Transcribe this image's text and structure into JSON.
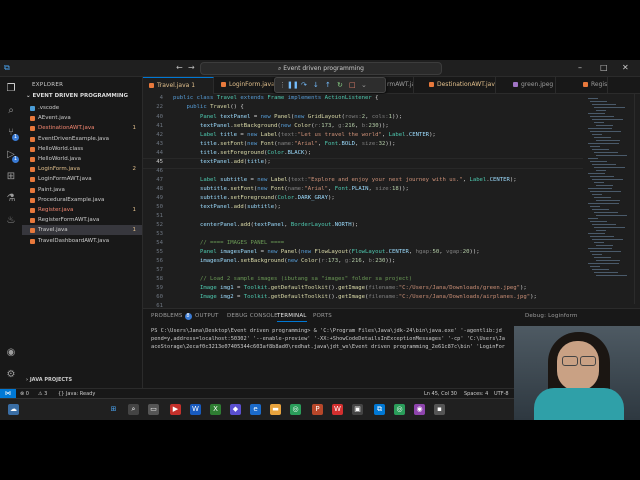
{
  "titlebar": {
    "search_text": "Event driven programming",
    "back": "←",
    "forward": "→"
  },
  "activity_badges": {
    "scm": "1",
    "run": "1"
  },
  "sidebar": {
    "header": "EXPLORER",
    "section": "EVENT DRIVEN PROGRAMMING",
    "bottom_section": "JAVA PROJECTS",
    "files": [
      {
        "name": ".vscode",
        "count": "",
        "state": "folder"
      },
      {
        "name": "AEvent.java",
        "count": "",
        "state": "normal"
      },
      {
        "name": "DestinationAWT.java",
        "count": "1",
        "state": "err"
      },
      {
        "name": "EventDrivenExample.java",
        "count": "",
        "state": "normal"
      },
      {
        "name": "HelloWorld.class",
        "count": "",
        "state": "normal"
      },
      {
        "name": "HelloWorld.java",
        "count": "",
        "state": "normal"
      },
      {
        "name": "LoginForm.java",
        "count": "2",
        "state": "mod"
      },
      {
        "name": "LoginFormAWT.java",
        "count": "",
        "state": "normal"
      },
      {
        "name": "Paint.java",
        "count": "",
        "state": "normal"
      },
      {
        "name": "ProceduralExample.java",
        "count": "",
        "state": "normal"
      },
      {
        "name": "Register.java",
        "count": "1",
        "state": "err"
      },
      {
        "name": "RegisterFormAWT.java",
        "count": "",
        "state": "normal"
      },
      {
        "name": "Travel.java",
        "count": "1",
        "state": "sel"
      },
      {
        "name": "TravelDashboardAWT.java",
        "count": "",
        "state": "normal"
      }
    ]
  },
  "tabs": [
    {
      "label": "Travel.java 1",
      "state": "active"
    },
    {
      "label": "LoginForm.java 2",
      "state": "modified"
    },
    {
      "label": "rmAWT.java",
      "state": "normal"
    },
    {
      "label": "DestinationAWT.java 1",
      "state": "modified"
    },
    {
      "label": "green.jpeg",
      "state": "normal"
    },
    {
      "label": "Regis",
      "state": "normal"
    }
  ],
  "breadcrumb_lines": [
    {
      "num": "4",
      "html": "<span class='k'>public class</span> <span class='c'>Travel</span> <span class='k'>extends</span> <span class='c'>Frame</span> <span class='k'>implements</span> <span class='c'>ActionListener</span> {"
    },
    {
      "num": "22",
      "html": "    <span class='k'>public</span> <span class='f'>Travel</span>() {"
    }
  ],
  "code_lines": [
    {
      "num": "40",
      "html": "        <span class='c'>Panel</span> <span class='v'>textPanel</span> = <span class='k'>new</span> <span class='f'>Panel</span>(<span class='k'>new</span> <span class='f'>GridLayout</span>(<span class='h'>rows:</span><span class='n'>2</span>, <span class='h'>cols:</span><span class='n'>1</span>));"
    },
    {
      "num": "41",
      "html": "        <span class='v'>textPanel</span>.<span class='f'>setBackground</span>(<span class='k'>new</span> <span class='f'>Color</span>(<span class='h'>r:</span><span class='n'>173</span>, <span class='h'>g:</span><span class='n'>216</span>, <span class='h'>b:</span><span class='n'>230</span>));"
    },
    {
      "num": "42",
      "html": "        <span class='c'>Label</span> <span class='v'>title</span> = <span class='k'>new</span> <span class='f'>Label</span>(<span class='h'>text:</span><span class='s'>\"Let us travel the world\"</span>, <span class='c'>Label</span>.<span class='v'>CENTER</span>);"
    },
    {
      "num": "43",
      "html": "        <span class='v'>title</span>.<span class='f'>setFont</span>(<span class='k'>new</span> <span class='f'>Font</span>(<span class='h'>name:</span><span class='s'>\"Arial\"</span>, <span class='c'>Font</span>.<span class='v'>BOLD</span>, <span class='h'>size:</span><span class='n'>32</span>));"
    },
    {
      "num": "44",
      "html": "        <span class='v'>title</span>.<span class='f'>setForeground</span>(<span class='c'>Color</span>.<span class='v'>BLACK</span>);"
    },
    {
      "num": "45",
      "html": "        <span class='v'>textPanel</span>.<span class='f'>add</span>(<span class='v'>title</span>);",
      "current": true
    },
    {
      "num": "46",
      "html": ""
    },
    {
      "num": "47",
      "html": "        <span class='c'>Label</span> <span class='v'>subtitle</span> = <span class='k'>new</span> <span class='f'>Label</span>(<span class='h'>text:</span><span class='s'>\"Explore and enjoy your next journey with us.\"</span>, <span class='c'>Label</span>.<span class='v'>CENTER</span>);"
    },
    {
      "num": "48",
      "html": "        <span class='v'>subtitle</span>.<span class='f'>setFont</span>(<span class='k'>new</span> <span class='f'>Font</span>(<span class='h'>name:</span><span class='s'>\"Arial\"</span>, <span class='c'>Font</span>.<span class='v'>PLAIN</span>, <span class='h'>size:</span><span class='n'>18</span>));"
    },
    {
      "num": "49",
      "html": "        <span class='v'>subtitle</span>.<span class='f'>setForeground</span>(<span class='c'>Color</span>.<span class='v'>DARK_GRAY</span>);"
    },
    {
      "num": "50",
      "html": "        <span class='v'>textPanel</span>.<span class='f'>add</span>(<span class='v'>subtitle</span>);"
    },
    {
      "num": "51",
      "html": ""
    },
    {
      "num": "52",
      "html": "        <span class='v'>centerPanel</span>.<span class='f'>add</span>(<span class='v'>textPanel</span>, <span class='c'>BorderLayout</span>.<span class='v'>NORTH</span>);"
    },
    {
      "num": "53",
      "html": ""
    },
    {
      "num": "54",
      "html": "        <span class='cm'>// ==== IMAGES PANEL ====</span>"
    },
    {
      "num": "55",
      "html": "        <span class='c'>Panel</span> <span class='v'>imagesPanel</span> = <span class='k'>new</span> <span class='f'>Panel</span>(<span class='k'>new</span> <span class='f'>FlowLayout</span>(<span class='c'>FlowLayout</span>.<span class='v'>CENTER</span>, <span class='h'>hgap:</span><span class='n'>50</span>, <span class='h'>vgap:</span><span class='n'>20</span>));"
    },
    {
      "num": "56",
      "html": "        <span class='v'>imagesPanel</span>.<span class='f'>setBackground</span>(<span class='k'>new</span> <span class='f'>Color</span>(<span class='h'>r:</span><span class='n'>173</span>, <span class='h'>g:</span><span class='n'>216</span>, <span class='h'>b:</span><span class='n'>230</span>));"
    },
    {
      "num": "57",
      "html": ""
    },
    {
      "num": "58",
      "html": "        <span class='cm'>// Load 2 sample images (ibutang sa \"images\" folder sa project)</span>"
    },
    {
      "num": "59",
      "html": "        <span class='c'>Image</span> <span class='v'>img1</span> = <span class='c'>Toolkit</span>.<span class='f'>getDefaultToolkit</span>().<span class='f'>getImage</span>(<span class='h'>filename:</span><span class='s'>\"C:/Users/Jana/Downloads/green.jpeg\"</span>);"
    },
    {
      "num": "60",
      "html": "        <span class='c'>Image</span> <span class='v'>img2</span> = <span class='c'>Toolkit</span>.<span class='f'>getDefaultToolkit</span>().<span class='f'>getImage</span>(<span class='h'>filename:</span><span class='s'>\"C:/Users/Jana/Downloads/airplanes.jpg\"</span>);"
    },
    {
      "num": "61",
      "html": ""
    }
  ],
  "panel": {
    "tabs": [
      "PROBLEMS",
      "OUTPUT",
      "DEBUG CONSOLE",
      "TERMINAL",
      "PORTS"
    ],
    "problems_count": "8",
    "active_tab": "TERMINAL",
    "debug_label": "Debug: Loginform",
    "terminal_lines": [
      "PS C:\\Users\\Jana\\Desktop\\Event driven programming> & 'C:\\Program Files\\Java\\jdk-24\\bin\\java.exe' '-agentlib:jd",
      "pend=y,address=localhost:50302' '--enable-preview' '-XX:+ShowCodeDetailsInExceptionMessages' '-cp' 'C:\\Users\\Ja",
      "aceStorage\\2ecaf0c3213e07405344c603af8b8ad0\\redhat.java\\jdt_ws\\Event driven programming_2e61c87c\\bin' 'LoginFor"
    ]
  },
  "statusbar": {
    "errors": "⊗ 0",
    "warnings": "⚠ 3",
    "java": "{} Java: Ready",
    "position": "Ln 45, Col 30",
    "spaces": "Spaces: 4",
    "encoding": "UTF-8"
  }
}
